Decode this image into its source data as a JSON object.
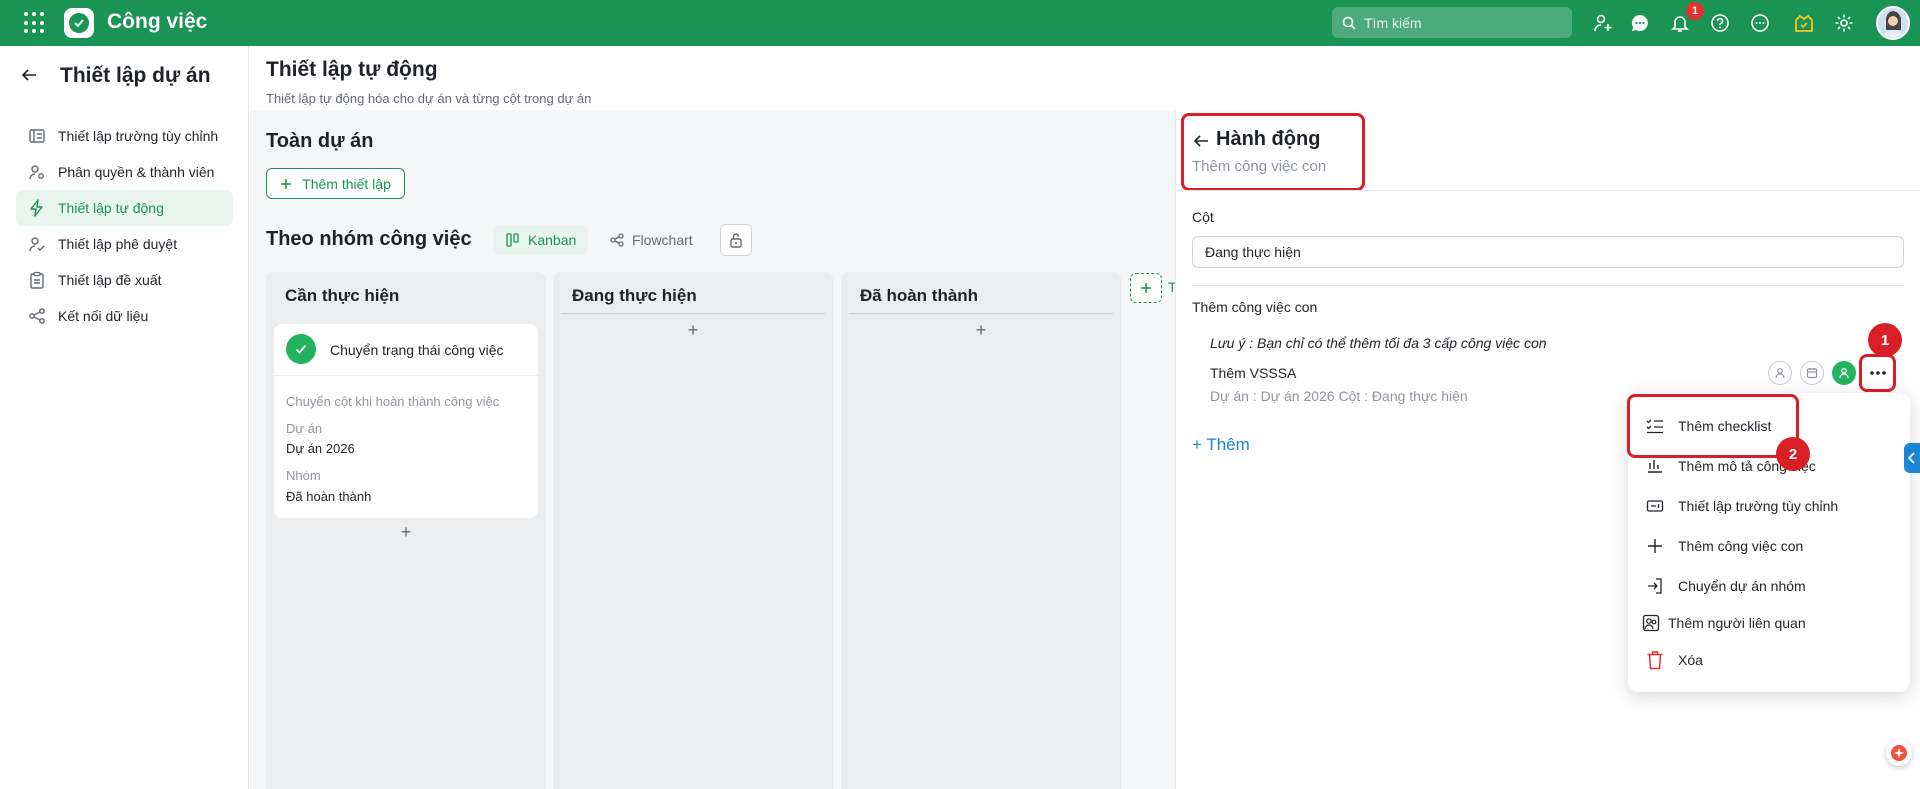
{
  "topbar": {
    "app_title": "Công việc",
    "search_placeholder": "Tìm kiếm",
    "notification_count": "1",
    "icons": [
      "add-user-icon",
      "chat-icon",
      "bell-icon",
      "help-icon",
      "more-circle-icon",
      "task-badge-icon",
      "gear-icon"
    ],
    "brand_color": "#1a9455"
  },
  "sidebar": {
    "title": "Thiết lập dự án",
    "items": [
      {
        "label": "Thiết lập trường tùy chỉnh",
        "icon": "custom-field-icon",
        "active": false
      },
      {
        "label": "Phân quyền & thành viên",
        "icon": "member-settings-icon",
        "active": false
      },
      {
        "label": "Thiết lập tự động",
        "icon": "lightning-icon",
        "active": true
      },
      {
        "label": "Thiết lập phê duyệt",
        "icon": "approval-icon",
        "active": false
      },
      {
        "label": "Thiết lập đề xuất",
        "icon": "clipboard-icon",
        "active": false
      },
      {
        "label": "Kết nối dữ liệu",
        "icon": "share-nodes-icon",
        "active": false
      }
    ]
  },
  "main": {
    "title": "Thiết lập tự động",
    "subtitle": "Thiết lập tự động hóa cho dự án và từng cột trong dự án",
    "section_title": "Toàn dự án",
    "add_setting_label": "Thêm thiết lập",
    "group_title": "Theo nhóm công việc",
    "tabs": [
      {
        "label": "Kanban",
        "active": true
      },
      {
        "label": "Flowchart",
        "active": false
      }
    ],
    "columns": [
      {
        "title": "Cần thực hiện"
      },
      {
        "title": "Đang thực hiện"
      },
      {
        "title": "Đã hoàn thành"
      }
    ],
    "card": {
      "title": "Chuyển trạng thái công việc",
      "description": "Chuyển cột khi hoàn thành công việc",
      "project_label": "Dự án",
      "project_value": "Dự án 2026",
      "group_label": "Nhóm",
      "group_value": "Đã hoàn thành"
    },
    "add_column_text": "T"
  },
  "panel": {
    "title": "Hành động",
    "subtitle": "Thêm công việc con",
    "column_label": "Cột",
    "column_value": "Đang thực hiện",
    "subtask_label": "Thêm công việc con",
    "note": "Lưu ý : Bạn chỉ có thể thêm tối đa 3 cấp công việc con",
    "task_name": "Thêm VSSSA",
    "task_meta": "Dự án :  Dự án 2026     Cột :  Đang thực hiện",
    "add_label": "+ Thêm",
    "step_1": "1",
    "step_2": "2"
  },
  "menu": {
    "items": [
      {
        "label": "Thêm checklist",
        "icon": "checklist-icon"
      },
      {
        "label": "Thêm mô tả công việc",
        "icon": "description-icon"
      },
      {
        "label": "Thiết lập trường tùy chỉnh",
        "icon": "custom-field-icon"
      },
      {
        "label": "Thêm công việc con",
        "icon": "plus-icon"
      },
      {
        "label": "Chuyển dự án nhóm",
        "icon": "move-icon"
      },
      {
        "label": "Thêm người liên quan",
        "icon": "people-icon"
      },
      {
        "label": "Xóa",
        "icon": "trash-icon"
      }
    ]
  },
  "colors": {
    "accent": "#1a9455",
    "highlight": "#d81f26",
    "link": "#1a86d4"
  }
}
